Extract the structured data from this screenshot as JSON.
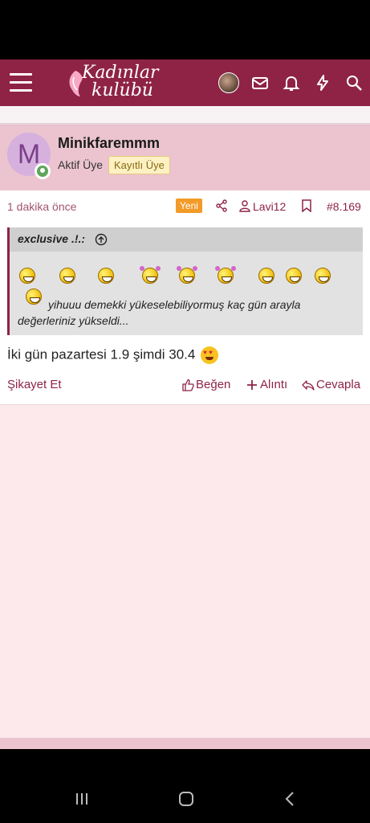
{
  "navbar": {
    "logo_line1": "Kadınlar",
    "logo_line2": "kulübü"
  },
  "post": {
    "avatar_letter": "M",
    "username": "Minikfaremmm",
    "user_title": "Aktif Üye",
    "user_badge": "Kayıtlı Üye",
    "time": "1 dakika önce",
    "new_badge": "Yeni",
    "tagged_user": "Lavi12",
    "post_number": "#8.169",
    "quote": {
      "author": "exclusive .!.:",
      "text": "yihuuu demekki yükeselebiliyormuş kaç gün arayla değerleriniz yükseldi..."
    },
    "body": "İki gün pazartesi 1.9 şimdi 30.4",
    "actions": {
      "report": "Şikayet Et",
      "like": "Beğen",
      "quote": "Alıntı",
      "reply": "Cevapla"
    }
  },
  "colors": {
    "primary": "#8e2346",
    "header_bg": "#ebc4cf",
    "page_bg": "#fde9ec"
  }
}
